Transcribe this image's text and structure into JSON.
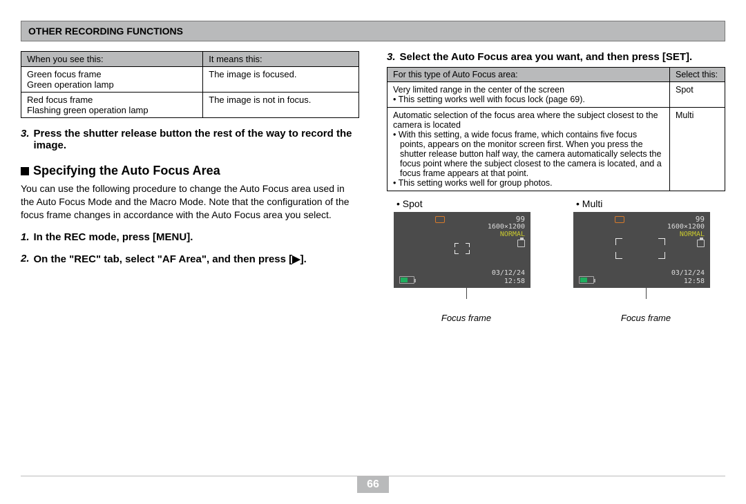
{
  "header": "OTHER RECORDING FUNCTIONS",
  "left": {
    "table": {
      "h1": "When you see this:",
      "h2": "It means this:",
      "r1c1a": "Green focus frame",
      "r1c1b": "Green operation lamp",
      "r1c2": "The image is focused.",
      "r2c1a": "Red focus frame",
      "r2c1b": "Flashing green operation lamp",
      "r2c2": "The image is not in focus."
    },
    "step3": "Press the shutter release button the rest of the way to record the image.",
    "section": "Specifying the Auto Focus Area",
    "body": "You can use the following procedure to change the Auto Focus area used in the Auto Focus Mode and the Macro Mode. Note that the configuration of the focus frame changes in accordance with the Auto Focus area you select.",
    "step1": "In the REC mode, press [MENU].",
    "step2": "On the \"REC\" tab, select \"AF Area\", and then press [▶]."
  },
  "right": {
    "step3": "Select the Auto Focus area you want, and then press [SET].",
    "table": {
      "h1": "For this type of Auto Focus area:",
      "h2": "Select this:",
      "r1c1a": "Very limited range in the center of the screen",
      "r1c1b": "• This setting works well with focus lock (page 69).",
      "r1c2": "Spot",
      "r2c1a": "Automatic selection of the focus area where the subject closest to the camera is located",
      "r2c1b": "• With this setting, a wide focus frame, which contains five focus points, appears on the monitor screen first.  When you press the shutter release button half way, the camera automatically selects the focus point where the subject closest to the camera is located, and a focus frame appears at that point.",
      "r2c1c": "• This setting works well for group photos.",
      "r2c2": "Multi"
    },
    "labels": {
      "spot": "• Spot",
      "multi": "• Multi"
    },
    "preview": {
      "count": "99",
      "res": "1600×1200",
      "normal": "NORMAL",
      "date": "03/12/24",
      "time": "12:58"
    },
    "callout": "Focus frame"
  },
  "page": "66"
}
